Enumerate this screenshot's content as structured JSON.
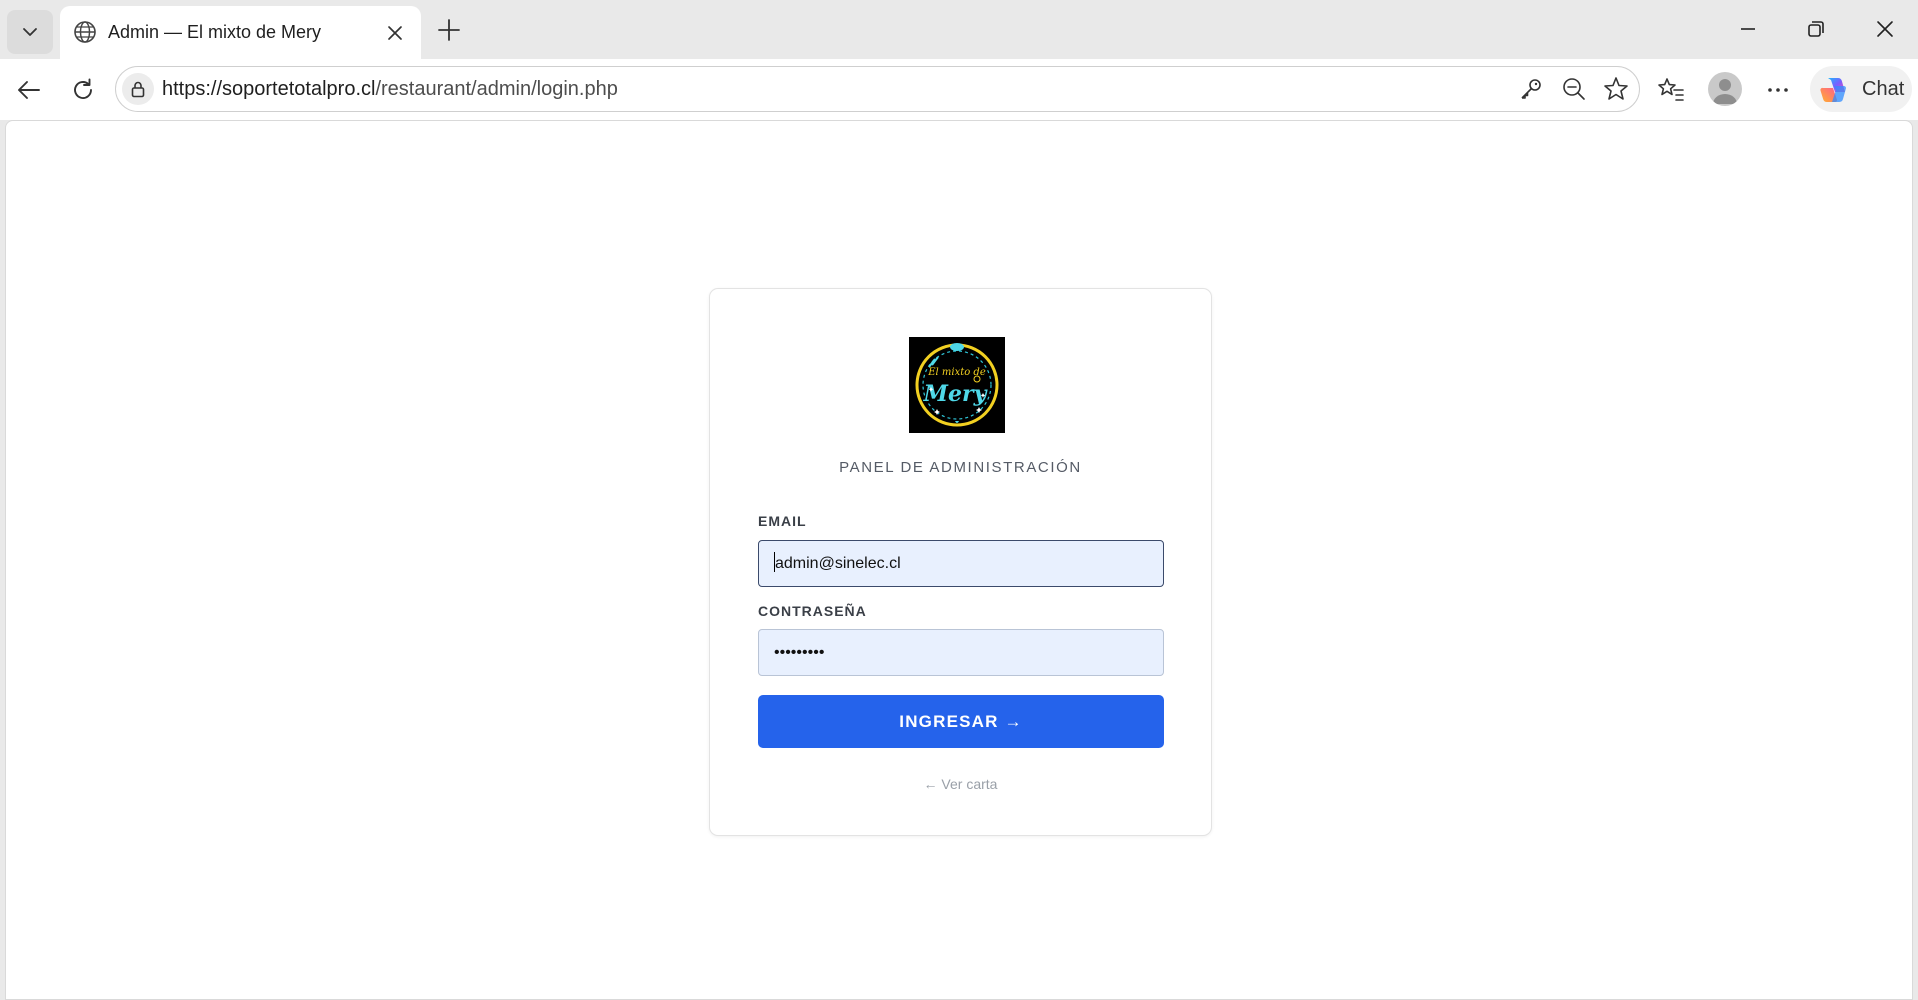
{
  "browser": {
    "tab_title": "Admin — El mixto de Mery",
    "url_host": "https://soportetotalpro.cl",
    "url_path": "/restaurant/admin/login.php",
    "chat_label": "Chat",
    "icons": {
      "tab_list": "chevron-down-icon",
      "favicon": "globe-icon",
      "tab_close": "close-icon",
      "new_tab": "plus-icon",
      "minimize": "minimize-icon",
      "restore": "restore-icon",
      "close_window": "close-icon",
      "back": "back-arrow-icon",
      "reload": "reload-icon",
      "lock": "lock-icon",
      "password": "key-icon",
      "zoom": "zoom-out-icon",
      "favorite": "star-icon",
      "favorites": "favorites-icon",
      "profile": "profile-icon",
      "more": "more-icon",
      "copilot": "copilot-icon"
    }
  },
  "login": {
    "logo_text_top": "El mixto de",
    "logo_text_main": "Mery",
    "panel_title": "PANEL DE ADMINISTRACIÓN",
    "email_label": "EMAIL",
    "email_value": "admin@sinelec.cl",
    "password_label": "CONTRASEÑA",
    "password_value": "•••••••••",
    "submit_label": "INGRESAR →",
    "back_link": "← Ver carta"
  },
  "colors": {
    "accent": "#2563eb",
    "input_bg": "#e8f0fe",
    "logo_bg": "#000000",
    "logo_ring": "#f2d021",
    "logo_text": "#4fd8e8"
  }
}
